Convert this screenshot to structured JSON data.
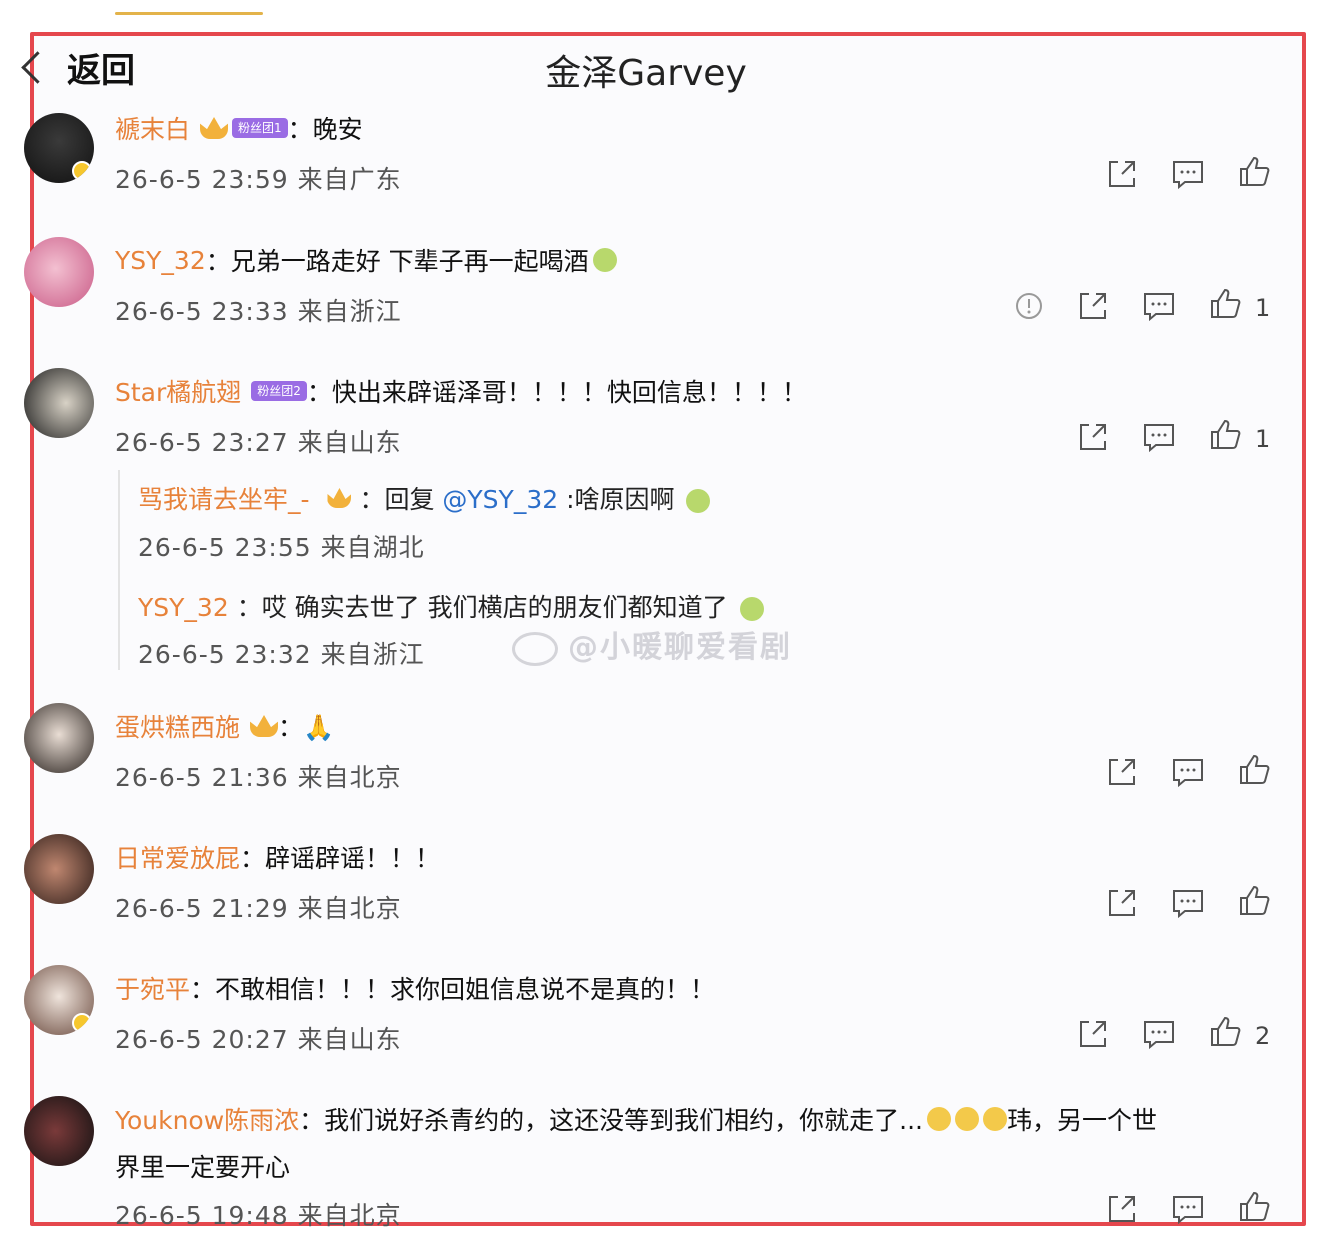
{
  "header": {
    "back_label": "返回",
    "title": "金泽Garvey"
  },
  "comments": [
    {
      "username": "褫末白",
      "tag": "粉丝团1",
      "text": "：晚安",
      "meta": "26-6-5 23:59 来自广东",
      "likes": ""
    },
    {
      "username": "YSY_32",
      "text": "：兄弟一路走好 下辈子再一起喝酒",
      "meta": "26-6-5 23:33 来自浙江",
      "likes": "1"
    },
    {
      "username": "Star橘航翅",
      "tag": "粉丝团2",
      "text": "：快出来辟谣泽哥！！！！快回信息！！！！",
      "meta": "26-6-5 23:27 来自山东",
      "likes": "1",
      "replies": [
        {
          "username": "骂我请去坐牢_-",
          "text_prefix": "：回复",
          "mention": "@YSY_32",
          "text": ":啥原因啊",
          "meta": "26-6-5 23:55 来自湖北"
        },
        {
          "username": "YSY_32",
          "text": "：哎 确实去世了 我们横店的朋友们都知道了",
          "meta": "26-6-5 23:32 来自浙江"
        }
      ]
    },
    {
      "username": "蛋烘糕西施",
      "text": "：🙏",
      "meta": "26-6-5 21:36 来自北京",
      "likes": ""
    },
    {
      "username": "日常爱放屁",
      "text": "：辟谣辟谣！！！",
      "meta": "26-6-5 21:29 来自北京",
      "likes": ""
    },
    {
      "username": "于宛平",
      "text": "：不敢相信！！！求你回姐信息说不是真的！！",
      "meta": "26-6-5 20:27 来自山东",
      "likes": "2"
    },
    {
      "username": "Youknow陈雨浓",
      "text": "：我们说好杀青约的，这还没等到我们相约，你就走了...",
      "text_tail": "玮，另一个世",
      "text_line2": "界里一定要开心",
      "meta": "26-6-5 19:48 来自北京",
      "likes": ""
    }
  ],
  "watermark": "@小暖聊爱看剧",
  "icons": {
    "share": "share-icon",
    "comment": "comment-icon",
    "like": "like-icon",
    "report": "report-icon",
    "back": "chevron-left-icon"
  },
  "colors": {
    "frame": "#e5474d",
    "username": "#e7823a",
    "mention": "#2b6ec9"
  }
}
